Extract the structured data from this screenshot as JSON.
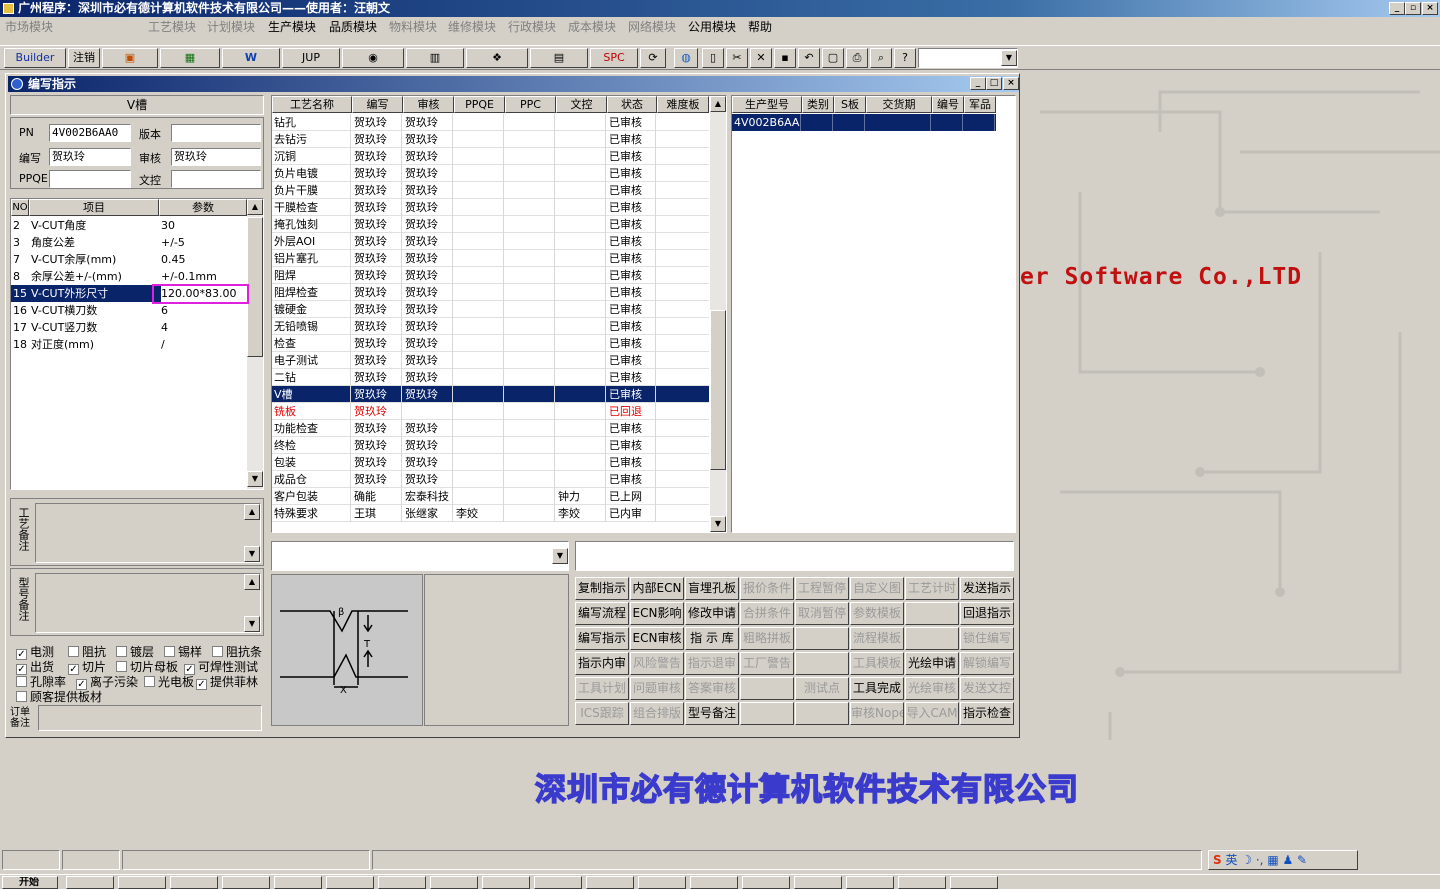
{
  "app": {
    "title": "广州程序：深圳市必有德计算机软件技术有限公司——使用者：汪朝文"
  },
  "menu": [
    {
      "label": "市场模块",
      "dis": true
    },
    {
      "label": "工艺模块",
      "dis": true
    },
    {
      "label": "计划模块",
      "dis": true
    },
    {
      "label": "生产模块",
      "dis": false
    },
    {
      "label": "品质模块",
      "dis": false
    },
    {
      "label": "物料模块",
      "dis": true
    },
    {
      "label": "维修模块",
      "dis": true
    },
    {
      "label": "行政模块",
      "dis": true
    },
    {
      "label": "成本模块",
      "dis": true
    },
    {
      "label": "网络模块",
      "dis": true
    },
    {
      "label": "公用模块",
      "dis": false
    },
    {
      "label": "帮助",
      "dis": false
    }
  ],
  "toolbar": {
    "builder": "Builder",
    "logout": "注销",
    "jup": "JUP",
    "spc": "SPC"
  },
  "window": {
    "title": "编写指示",
    "process_name": "V槽"
  },
  "fields": {
    "pn_label": "PN",
    "pn_value": "4V002B6AA0",
    "version_label": "版本",
    "version_value": "",
    "editor_label": "编写",
    "editor_value": "贺玖玲",
    "reviewer_label": "审核",
    "reviewer_value": "贺玖玲",
    "ppqe_label": "PPQE",
    "ppqe_value": "",
    "doc_label": "文控",
    "doc_value": ""
  },
  "params": {
    "headers": [
      "NO",
      "项目",
      "参数"
    ],
    "rows": [
      {
        "no": "2",
        "item": "V-CUT角度",
        "value": "30"
      },
      {
        "no": "3",
        "item": "角度公差",
        "value": "+/-5"
      },
      {
        "no": "7",
        "item": "V-CUT余厚(mm)",
        "value": "0.45"
      },
      {
        "no": "8",
        "item": "余厚公差+/-(mm)",
        "value": "+/-0.1mm"
      },
      {
        "no": "15",
        "item": "V-CUT外形尺寸",
        "value": "120.00*83.00",
        "selected": true
      },
      {
        "no": "16",
        "item": "V-CUT横刀数",
        "value": "6"
      },
      {
        "no": "17",
        "item": "V-CUT竖刀数",
        "value": "4"
      },
      {
        "no": "18",
        "item": "对正度(mm)",
        "value": "/"
      }
    ]
  },
  "remarks": {
    "process": "工艺备注",
    "model": "型号备注",
    "order": "订单备注"
  },
  "checkboxes": [
    {
      "label": "电测",
      "checked": true
    },
    {
      "label": "阻抗",
      "checked": false
    },
    {
      "label": "镀层",
      "checked": false
    },
    {
      "label": "锡样",
      "checked": false
    },
    {
      "label": "阻抗条",
      "checked": false
    },
    {
      "label": "出货",
      "checked": true
    },
    {
      "label": "切片",
      "checked": true
    },
    {
      "label": "切片母板",
      "checked": false
    },
    {
      "label": "可焊性测试",
      "checked": true
    },
    {
      "label": "孔隙率",
      "checked": false
    },
    {
      "label": "离子污染",
      "checked": true
    },
    {
      "label": "光电板",
      "checked": false
    },
    {
      "label": "提供菲林",
      "checked": true
    },
    {
      "label": "顾客提供板材",
      "checked": false
    }
  ],
  "process_table": {
    "headers": [
      "工艺名称",
      "编写",
      "审核",
      "PPQE",
      "PPC",
      "文控",
      "状态",
      "难度板"
    ],
    "rows": [
      {
        "name": "钻孔",
        "editor": "贺玖玲",
        "reviewer": "贺玖玲",
        "ppqe": "",
        "ppc": "",
        "doc": "",
        "status": "已审核"
      },
      {
        "name": "去钻污",
        "editor": "贺玖玲",
        "reviewer": "贺玖玲",
        "ppqe": "",
        "ppc": "",
        "doc": "",
        "status": "已审核"
      },
      {
        "name": "沉铜",
        "editor": "贺玖玲",
        "reviewer": "贺玖玲",
        "ppqe": "",
        "ppc": "",
        "doc": "",
        "status": "已审核"
      },
      {
        "name": "负片电镀",
        "editor": "贺玖玲",
        "reviewer": "贺玖玲",
        "ppqe": "",
        "ppc": "",
        "doc": "",
        "status": "已审核"
      },
      {
        "name": "负片干膜",
        "editor": "贺玖玲",
        "reviewer": "贺玖玲",
        "ppqe": "",
        "ppc": "",
        "doc": "",
        "status": "已审核"
      },
      {
        "name": "干膜检查",
        "editor": "贺玖玲",
        "reviewer": "贺玖玲",
        "ppqe": "",
        "ppc": "",
        "doc": "",
        "status": "已审核"
      },
      {
        "name": "掩孔蚀刻",
        "editor": "贺玖玲",
        "reviewer": "贺玖玲",
        "ppqe": "",
        "ppc": "",
        "doc": "",
        "status": "已审核"
      },
      {
        "name": "外层AOI",
        "editor": "贺玖玲",
        "reviewer": "贺玖玲",
        "ppqe": "",
        "ppc": "",
        "doc": "",
        "status": "已审核"
      },
      {
        "name": "铝片塞孔",
        "editor": "贺玖玲",
        "reviewer": "贺玖玲",
        "ppqe": "",
        "ppc": "",
        "doc": "",
        "status": "已审核"
      },
      {
        "name": "阻焊",
        "editor": "贺玖玲",
        "reviewer": "贺玖玲",
        "ppqe": "",
        "ppc": "",
        "doc": "",
        "status": "已审核"
      },
      {
        "name": "阻焊检查",
        "editor": "贺玖玲",
        "reviewer": "贺玖玲",
        "ppqe": "",
        "ppc": "",
        "doc": "",
        "status": "已审核"
      },
      {
        "name": "镀硬金",
        "editor": "贺玖玲",
        "reviewer": "贺玖玲",
        "ppqe": "",
        "ppc": "",
        "doc": "",
        "status": "已审核"
      },
      {
        "name": "无铅喷锡",
        "editor": "贺玖玲",
        "reviewer": "贺玖玲",
        "ppqe": "",
        "ppc": "",
        "doc": "",
        "status": "已审核"
      },
      {
        "name": "检查",
        "editor": "贺玖玲",
        "reviewer": "贺玖玲",
        "ppqe": "",
        "ppc": "",
        "doc": "",
        "status": "已审核"
      },
      {
        "name": "电子测试",
        "editor": "贺玖玲",
        "reviewer": "贺玖玲",
        "ppqe": "",
        "ppc": "",
        "doc": "",
        "status": "已审核"
      },
      {
        "name": "二钻",
        "editor": "贺玖玲",
        "reviewer": "贺玖玲",
        "ppqe": "",
        "ppc": "",
        "doc": "",
        "status": "已审核"
      },
      {
        "name": "V槽",
        "editor": "贺玖玲",
        "reviewer": "贺玖玲",
        "ppqe": "",
        "ppc": "",
        "doc": "",
        "status": "已审核",
        "selected": true
      },
      {
        "name": "铣板",
        "editor": "贺玖玲",
        "reviewer": "",
        "ppqe": "",
        "ppc": "",
        "doc": "",
        "status": "已回退",
        "red": true
      },
      {
        "name": "功能检查",
        "editor": "贺玖玲",
        "reviewer": "贺玖玲",
        "ppqe": "",
        "ppc": "",
        "doc": "",
        "status": "已审核"
      },
      {
        "name": "终检",
        "editor": "贺玖玲",
        "reviewer": "贺玖玲",
        "ppqe": "",
        "ppc": "",
        "doc": "",
        "status": "已审核"
      },
      {
        "name": "包装",
        "editor": "贺玖玲",
        "reviewer": "贺玖玲",
        "ppqe": "",
        "ppc": "",
        "doc": "",
        "status": "已审核"
      },
      {
        "name": "成品仓",
        "editor": "贺玖玲",
        "reviewer": "贺玖玲",
        "ppqe": "",
        "ppc": "",
        "doc": "",
        "status": "已审核"
      },
      {
        "name": "客户包装",
        "editor": "确能",
        "reviewer": "宏泰科技",
        "ppqe": "",
        "ppc": "",
        "doc": "钟力",
        "status": "已上网"
      },
      {
        "name": "特殊要求",
        "editor": "王琪",
        "reviewer": "张继家",
        "ppqe": "李姣",
        "ppc": "",
        "doc": "李姣",
        "status": "已内审"
      }
    ]
  },
  "model_table": {
    "headers": [
      "生产型号",
      "类别",
      "S板",
      "交货期",
      "编号",
      "军品"
    ],
    "rows": [
      {
        "model": "4V002B6AA0",
        "type": "",
        "s": "",
        "due": "",
        "no": "",
        "mil": ""
      }
    ]
  },
  "buttons": [
    [
      {
        "label": "复制指示",
        "dis": false
      },
      {
        "label": "内部ECN",
        "dis": false
      },
      {
        "label": "盲埋孔板",
        "dis": false
      },
      {
        "label": "报价条件",
        "dis": true
      },
      {
        "label": "工程暂停",
        "dis": true
      },
      {
        "label": "自定义图",
        "dis": true
      },
      {
        "label": "工艺计时",
        "dis": true
      },
      {
        "label": "发送指示",
        "dis": false
      }
    ],
    [
      {
        "label": "编写流程",
        "dis": false
      },
      {
        "label": "ECN影响",
        "dis": false
      },
      {
        "label": "修改申请",
        "dis": false
      },
      {
        "label": "合拼条件",
        "dis": true
      },
      {
        "label": "取消暂停",
        "dis": true
      },
      {
        "label": "参数模板",
        "dis": true
      },
      {
        "label": "",
        "dis": true
      },
      {
        "label": "回退指示",
        "dis": false
      }
    ],
    [
      {
        "label": "编写指示",
        "dis": false
      },
      {
        "label": "ECN审核",
        "dis": false
      },
      {
        "label": "指 示 库",
        "dis": false
      },
      {
        "label": "粗略拼板",
        "dis": true
      },
      {
        "label": "",
        "dis": true
      },
      {
        "label": "流程模板",
        "dis": true
      },
      {
        "label": "",
        "dis": true
      },
      {
        "label": "锁住编写",
        "dis": true
      }
    ],
    [
      {
        "label": "指示内审",
        "dis": false
      },
      {
        "label": "风险警告",
        "dis": true
      },
      {
        "label": "指示退审",
        "dis": true
      },
      {
        "label": "工厂警告",
        "dis": true
      },
      {
        "label": "",
        "dis": true
      },
      {
        "label": "工具模板",
        "dis": true
      },
      {
        "label": "光绘申请",
        "dis": false
      },
      {
        "label": "解锁编写",
        "dis": true
      }
    ],
    [
      {
        "label": "工具计划",
        "dis": true
      },
      {
        "label": "问题审核",
        "dis": true
      },
      {
        "label": "答案审核",
        "dis": true
      },
      {
        "label": "",
        "dis": true
      },
      {
        "label": "测试点",
        "dis": true
      },
      {
        "label": "工具完成",
        "dis": false
      },
      {
        "label": "光绘审核",
        "dis": true
      },
      {
        "label": "发送文控",
        "dis": true
      }
    ],
    [
      {
        "label": "ICS跟踪",
        "dis": true
      },
      {
        "label": "组合排版",
        "dis": true
      },
      {
        "label": "型号备注",
        "dis": false
      },
      {
        "label": "",
        "dis": true
      },
      {
        "label": "",
        "dis": true
      },
      {
        "label": "审核Nope",
        "dis": true
      },
      {
        "label": "导入CAM",
        "dis": true
      },
      {
        "label": "指示检查",
        "dis": false
      }
    ]
  ],
  "background": {
    "company_cn": "深圳市必有德计算机软件技术有限公司",
    "company_en": "er Software Co.,LTD"
  },
  "taskbar": {
    "start": "开始"
  },
  "colors": {
    "title_bg": "#0a246a",
    "select_bg": "#0a246a",
    "red": "#e00000",
    "banner": "#3a3acc"
  }
}
